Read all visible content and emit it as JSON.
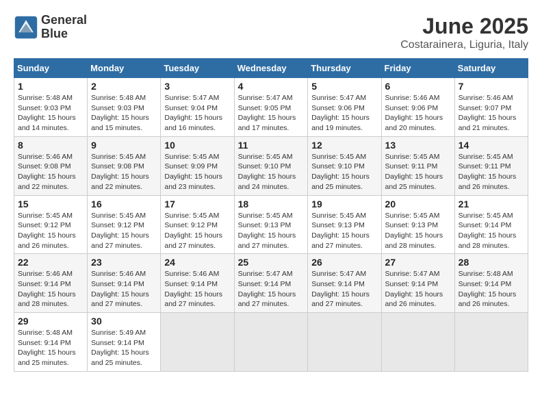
{
  "logo": {
    "line1": "General",
    "line2": "Blue"
  },
  "title": "June 2025",
  "subtitle": "Costarainera, Liguria, Italy",
  "weekdays": [
    "Sunday",
    "Monday",
    "Tuesday",
    "Wednesday",
    "Thursday",
    "Friday",
    "Saturday"
  ],
  "weeks": [
    [
      {
        "day": "1",
        "sunrise": "Sunrise: 5:48 AM",
        "sunset": "Sunset: 9:03 PM",
        "daylight": "Daylight: 15 hours and 14 minutes."
      },
      {
        "day": "2",
        "sunrise": "Sunrise: 5:48 AM",
        "sunset": "Sunset: 9:03 PM",
        "daylight": "Daylight: 15 hours and 15 minutes."
      },
      {
        "day": "3",
        "sunrise": "Sunrise: 5:47 AM",
        "sunset": "Sunset: 9:04 PM",
        "daylight": "Daylight: 15 hours and 16 minutes."
      },
      {
        "day": "4",
        "sunrise": "Sunrise: 5:47 AM",
        "sunset": "Sunset: 9:05 PM",
        "daylight": "Daylight: 15 hours and 17 minutes."
      },
      {
        "day": "5",
        "sunrise": "Sunrise: 5:47 AM",
        "sunset": "Sunset: 9:06 PM",
        "daylight": "Daylight: 15 hours and 19 minutes."
      },
      {
        "day": "6",
        "sunrise": "Sunrise: 5:46 AM",
        "sunset": "Sunset: 9:06 PM",
        "daylight": "Daylight: 15 hours and 20 minutes."
      },
      {
        "day": "7",
        "sunrise": "Sunrise: 5:46 AM",
        "sunset": "Sunset: 9:07 PM",
        "daylight": "Daylight: 15 hours and 21 minutes."
      }
    ],
    [
      {
        "day": "8",
        "sunrise": "Sunrise: 5:46 AM",
        "sunset": "Sunset: 9:08 PM",
        "daylight": "Daylight: 15 hours and 22 minutes."
      },
      {
        "day": "9",
        "sunrise": "Sunrise: 5:45 AM",
        "sunset": "Sunset: 9:08 PM",
        "daylight": "Daylight: 15 hours and 22 minutes."
      },
      {
        "day": "10",
        "sunrise": "Sunrise: 5:45 AM",
        "sunset": "Sunset: 9:09 PM",
        "daylight": "Daylight: 15 hours and 23 minutes."
      },
      {
        "day": "11",
        "sunrise": "Sunrise: 5:45 AM",
        "sunset": "Sunset: 9:10 PM",
        "daylight": "Daylight: 15 hours and 24 minutes."
      },
      {
        "day": "12",
        "sunrise": "Sunrise: 5:45 AM",
        "sunset": "Sunset: 9:10 PM",
        "daylight": "Daylight: 15 hours and 25 minutes."
      },
      {
        "day": "13",
        "sunrise": "Sunrise: 5:45 AM",
        "sunset": "Sunset: 9:11 PM",
        "daylight": "Daylight: 15 hours and 25 minutes."
      },
      {
        "day": "14",
        "sunrise": "Sunrise: 5:45 AM",
        "sunset": "Sunset: 9:11 PM",
        "daylight": "Daylight: 15 hours and 26 minutes."
      }
    ],
    [
      {
        "day": "15",
        "sunrise": "Sunrise: 5:45 AM",
        "sunset": "Sunset: 9:12 PM",
        "daylight": "Daylight: 15 hours and 26 minutes."
      },
      {
        "day": "16",
        "sunrise": "Sunrise: 5:45 AM",
        "sunset": "Sunset: 9:12 PM",
        "daylight": "Daylight: 15 hours and 27 minutes."
      },
      {
        "day": "17",
        "sunrise": "Sunrise: 5:45 AM",
        "sunset": "Sunset: 9:12 PM",
        "daylight": "Daylight: 15 hours and 27 minutes."
      },
      {
        "day": "18",
        "sunrise": "Sunrise: 5:45 AM",
        "sunset": "Sunset: 9:13 PM",
        "daylight": "Daylight: 15 hours and 27 minutes."
      },
      {
        "day": "19",
        "sunrise": "Sunrise: 5:45 AM",
        "sunset": "Sunset: 9:13 PM",
        "daylight": "Daylight: 15 hours and 27 minutes."
      },
      {
        "day": "20",
        "sunrise": "Sunrise: 5:45 AM",
        "sunset": "Sunset: 9:13 PM",
        "daylight": "Daylight: 15 hours and 28 minutes."
      },
      {
        "day": "21",
        "sunrise": "Sunrise: 5:45 AM",
        "sunset": "Sunset: 9:14 PM",
        "daylight": "Daylight: 15 hours and 28 minutes."
      }
    ],
    [
      {
        "day": "22",
        "sunrise": "Sunrise: 5:46 AM",
        "sunset": "Sunset: 9:14 PM",
        "daylight": "Daylight: 15 hours and 28 minutes."
      },
      {
        "day": "23",
        "sunrise": "Sunrise: 5:46 AM",
        "sunset": "Sunset: 9:14 PM",
        "daylight": "Daylight: 15 hours and 27 minutes."
      },
      {
        "day": "24",
        "sunrise": "Sunrise: 5:46 AM",
        "sunset": "Sunset: 9:14 PM",
        "daylight": "Daylight: 15 hours and 27 minutes."
      },
      {
        "day": "25",
        "sunrise": "Sunrise: 5:47 AM",
        "sunset": "Sunset: 9:14 PM",
        "daylight": "Daylight: 15 hours and 27 minutes."
      },
      {
        "day": "26",
        "sunrise": "Sunrise: 5:47 AM",
        "sunset": "Sunset: 9:14 PM",
        "daylight": "Daylight: 15 hours and 27 minutes."
      },
      {
        "day": "27",
        "sunrise": "Sunrise: 5:47 AM",
        "sunset": "Sunset: 9:14 PM",
        "daylight": "Daylight: 15 hours and 26 minutes."
      },
      {
        "day": "28",
        "sunrise": "Sunrise: 5:48 AM",
        "sunset": "Sunset: 9:14 PM",
        "daylight": "Daylight: 15 hours and 26 minutes."
      }
    ],
    [
      {
        "day": "29",
        "sunrise": "Sunrise: 5:48 AM",
        "sunset": "Sunset: 9:14 PM",
        "daylight": "Daylight: 15 hours and 25 minutes."
      },
      {
        "day": "30",
        "sunrise": "Sunrise: 5:49 AM",
        "sunset": "Sunset: 9:14 PM",
        "daylight": "Daylight: 15 hours and 25 minutes."
      },
      null,
      null,
      null,
      null,
      null
    ]
  ]
}
